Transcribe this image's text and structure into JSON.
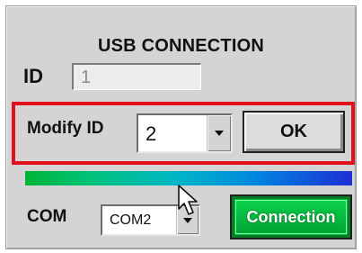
{
  "window": {
    "title": "USB CONNECTION"
  },
  "id_row": {
    "label": "ID",
    "value": "1"
  },
  "modify_row": {
    "label": "Modify ID",
    "selected": "2",
    "ok_label": "OK"
  },
  "com_row": {
    "label": "COM",
    "selected": "COM2"
  },
  "connection_button": {
    "label": "Connection"
  },
  "icons": {
    "dropdown": "chevron-down-icon",
    "cursor": "mouse-pointer-icon"
  },
  "colors": {
    "highlight_border": "#e0101e",
    "connection_button": "#00c23a",
    "gradient_start": "#00b437",
    "gradient_end": "#1e2fd6"
  }
}
